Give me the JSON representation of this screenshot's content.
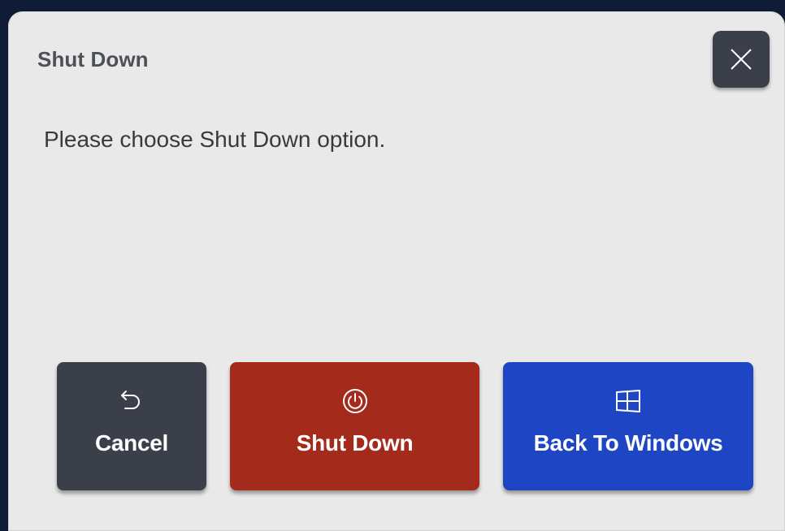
{
  "dialog": {
    "title": "Shut Down",
    "message": "Please choose Shut Down option.",
    "close_icon": "close-icon"
  },
  "buttons": {
    "cancel": {
      "label": "Cancel",
      "icon": "undo-arrow-icon"
    },
    "shutdown": {
      "label": "Shut Down",
      "icon": "power-icon"
    },
    "windows": {
      "label": "Back To Windows",
      "icon": "windows-logo-icon"
    }
  },
  "colors": {
    "dialog_bg": "#e9e9e9",
    "dark_button": "#3b3f4a",
    "shutdown_red": "#a42a1b",
    "windows_blue": "#1d45c4",
    "backdrop": "#0f1a36"
  }
}
